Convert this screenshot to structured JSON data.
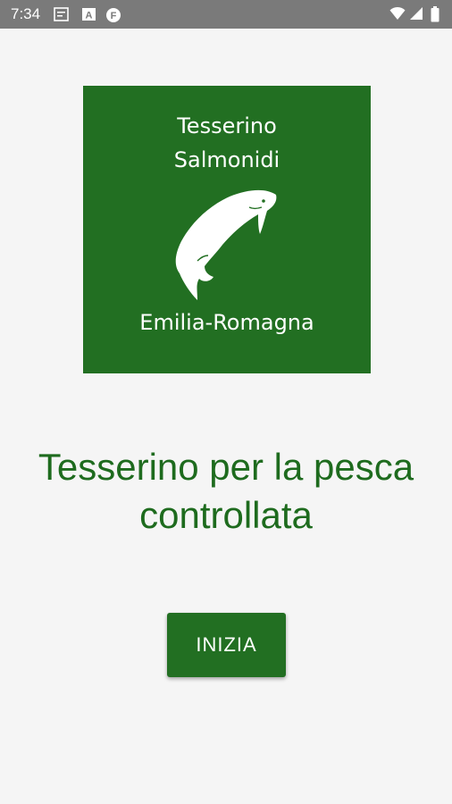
{
  "status_bar": {
    "time": "7:34",
    "left_icons": [
      "notification-box-icon",
      "notification-a-icon",
      "notification-f-icon"
    ],
    "right_icons": [
      "wifi-icon",
      "signal-icon",
      "battery-icon"
    ]
  },
  "logo": {
    "title_line1": "Tesserino",
    "title_line2": "Salmonidi",
    "region": "Emilia-Romagna",
    "icon": "fish-icon"
  },
  "headline": {
    "line1": "Tesserino per la pesca",
    "line2": "controllata"
  },
  "button": {
    "label": "INIZIA"
  },
  "colors": {
    "brand_green": "#226f22",
    "headline_green": "#1e6b1e",
    "background": "#f5f5f5",
    "status_bar": "#7a7a7a"
  }
}
